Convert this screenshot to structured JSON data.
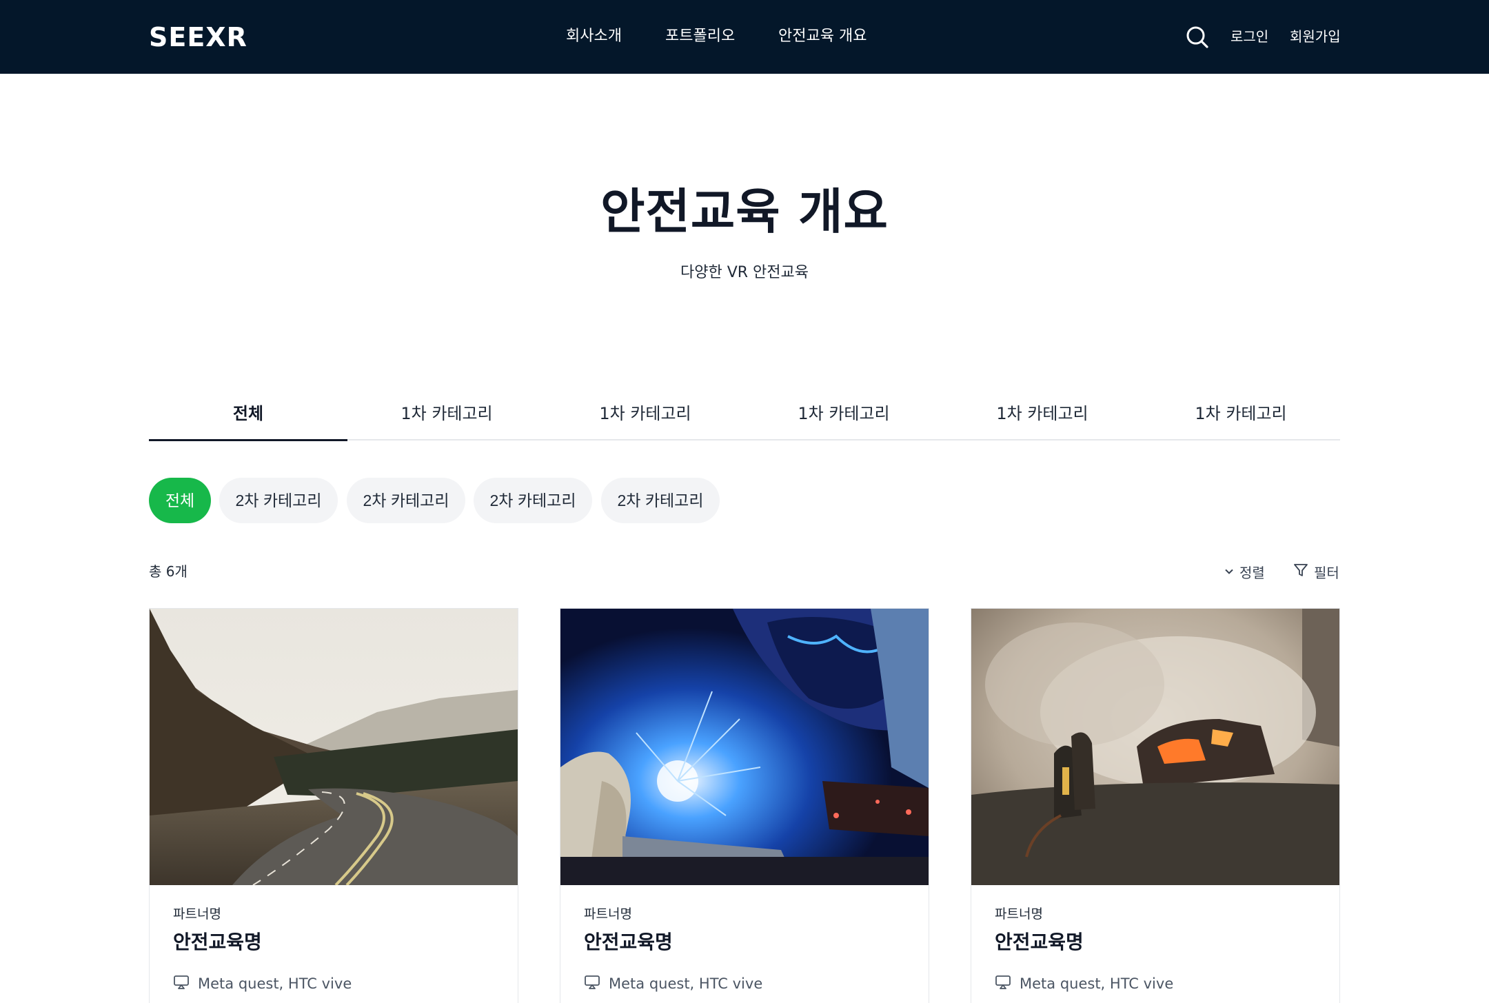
{
  "header": {
    "logo": "SEEXR",
    "nav": [
      "회사소개",
      "포트폴리오",
      "안전교육 개요"
    ],
    "login": "로그인",
    "signup": "회원가입",
    "background_color": "#04172a"
  },
  "hero": {
    "title": "안전교육 개요",
    "subtitle": "다양한 VR 안전교육"
  },
  "primary_tabs": [
    "전체",
    "1차 카테고리",
    "1차 카테고리",
    "1차 카테고리",
    "1차 카테고리",
    "1차 카테고리"
  ],
  "secondary_chips": [
    "전체",
    "2차 카테고리",
    "2차 카테고리",
    "2차 카테고리",
    "2차 카테고리"
  ],
  "accent_color": "#17b84a",
  "results": {
    "total": "총 6개",
    "sort_label": "정렬",
    "filter_label": "필터"
  },
  "cards": [
    {
      "partner": "파트너명",
      "name": "안전교육명",
      "devices": "Meta quest, HTC vive",
      "image": "winding-road-photo"
    },
    {
      "partner": "파트너명",
      "name": "안전교육명",
      "devices": "Meta quest, HTC vive",
      "image": "welding-sparks-photo"
    },
    {
      "partner": "파트너명",
      "name": "안전교육명",
      "devices": "Meta quest, HTC vive",
      "image": "firefighters-car-fire-photo"
    }
  ]
}
